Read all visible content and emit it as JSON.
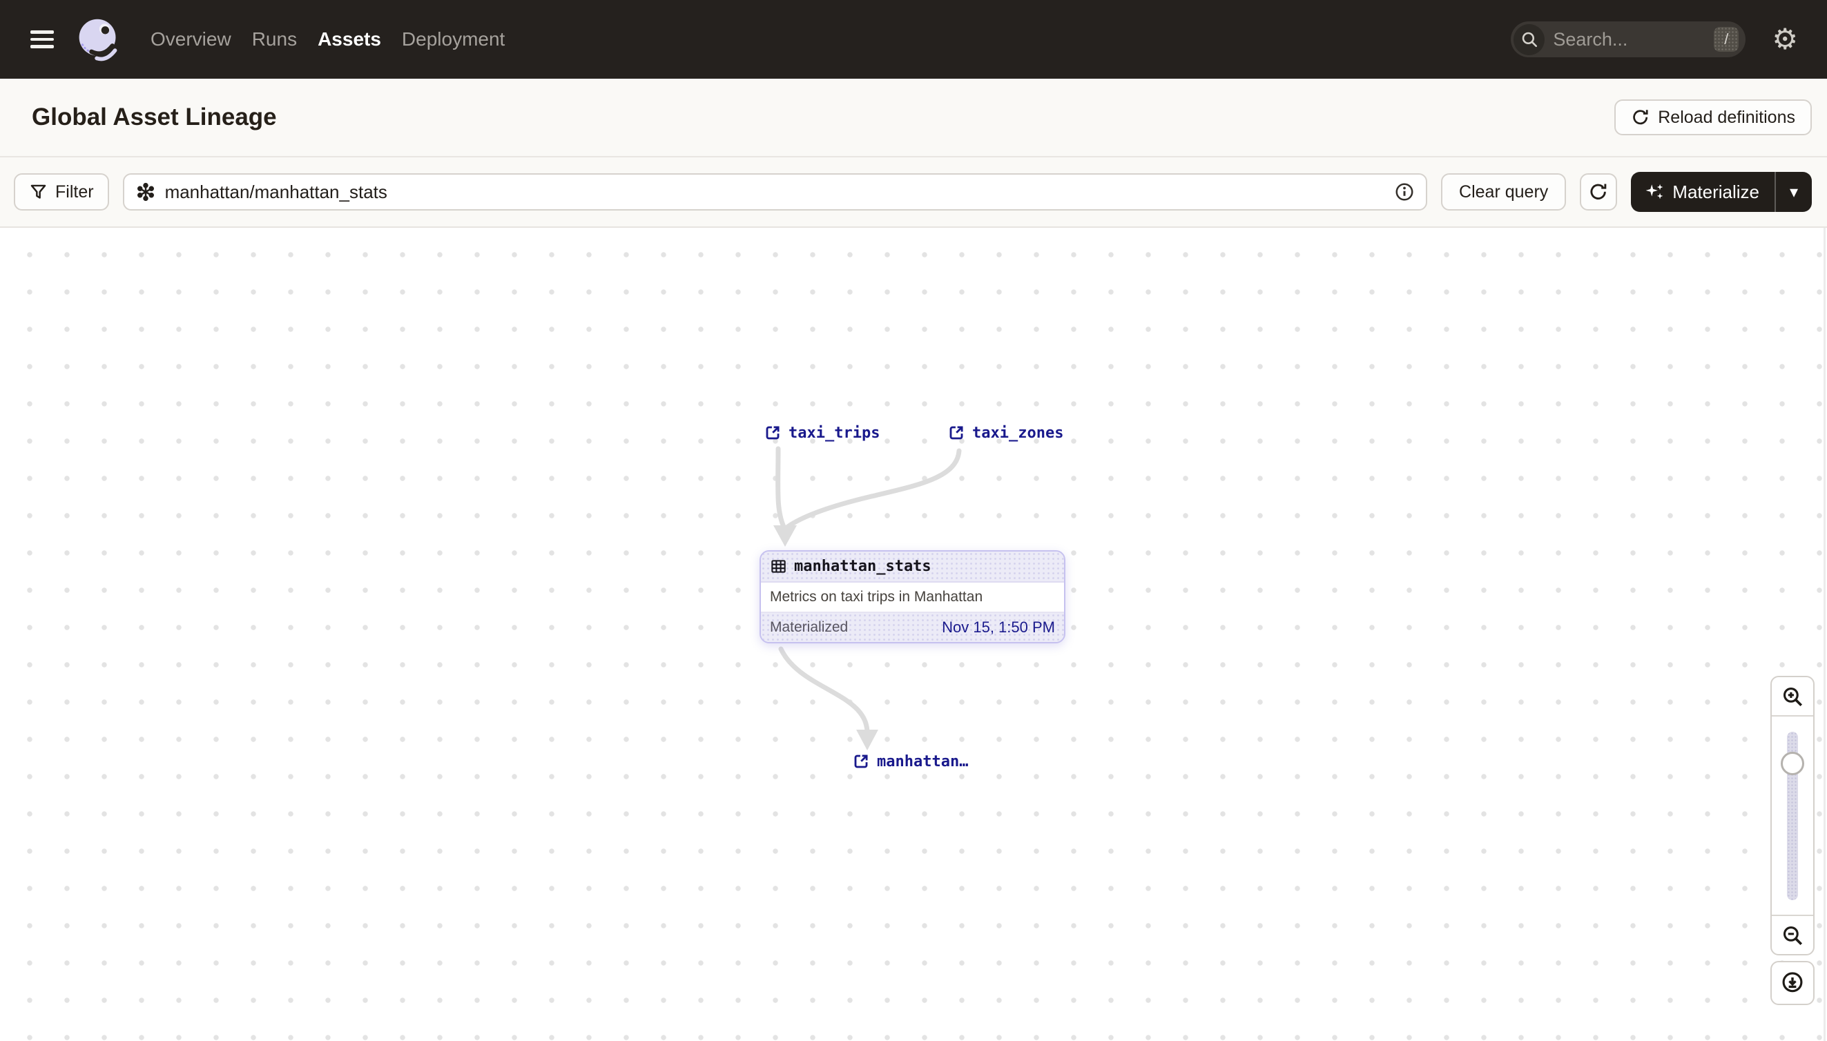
{
  "nav": {
    "items": [
      {
        "label": "Overview",
        "active": false
      },
      {
        "label": "Runs",
        "active": false
      },
      {
        "label": "Assets",
        "active": true
      },
      {
        "label": "Deployment",
        "active": false
      }
    ],
    "search": {
      "placeholder": "Search...",
      "shortcut": "/"
    }
  },
  "header": {
    "title": "Global Asset Lineage",
    "reload_button": "Reload definitions"
  },
  "toolbar": {
    "filter_label": "Filter",
    "query_value": "manhattan/manhattan_stats",
    "clear_query_label": "Clear query",
    "materialize_label": "Materialize"
  },
  "graph": {
    "nodes": {
      "taxi_trips": {
        "label": "taxi_trips"
      },
      "taxi_zones": {
        "label": "taxi_zones"
      },
      "manhattan_truncated": {
        "label": "manhattan…"
      }
    },
    "card": {
      "name": "manhattan_stats",
      "description": "Metrics on taxi trips in Manhattan",
      "status_label": "Materialized",
      "status_time": "Nov 15, 1:50 PM"
    }
  },
  "icons": {
    "gear": "⚙",
    "caret_down": "▾"
  },
  "colors": {
    "nav_bg": "#25211e",
    "accent_navy": "#19198c",
    "card_border": "#c6c1ef",
    "edge_gray": "#dcdcdc",
    "page_bg": "#faf9f6"
  }
}
